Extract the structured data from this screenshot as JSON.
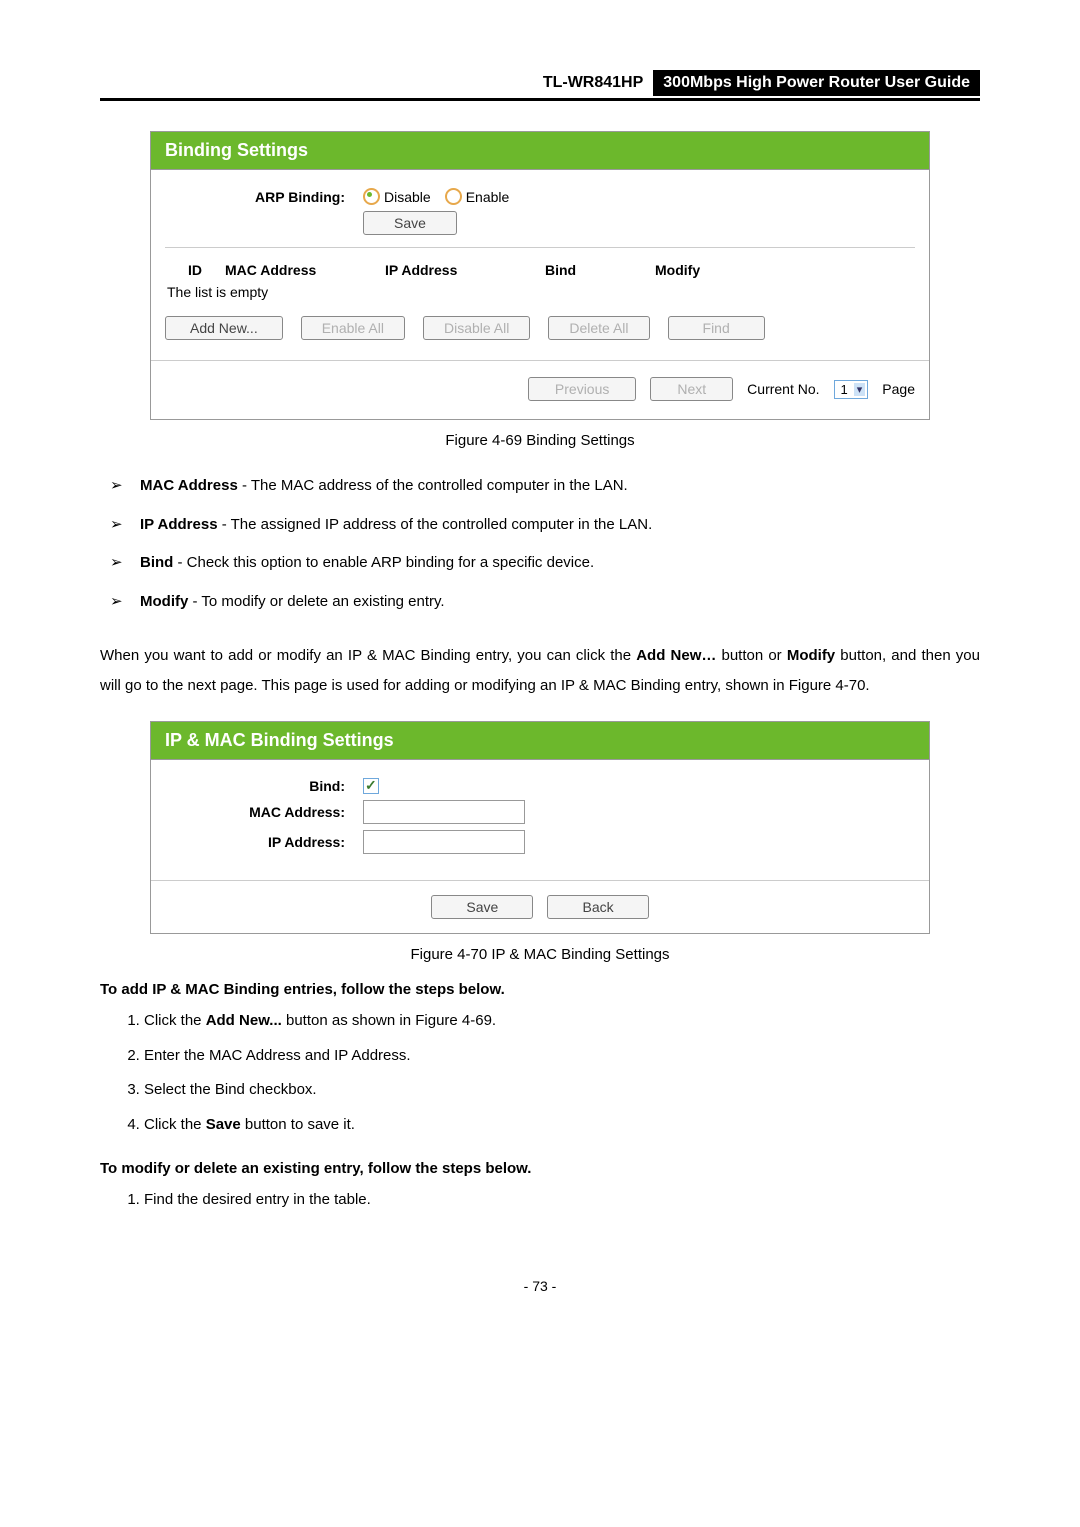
{
  "header": {
    "model": "TL-WR841HP",
    "title": "300Mbps High Power Router User Guide"
  },
  "panel1": {
    "title": "Binding Settings",
    "arp_label": "ARP Binding:",
    "disable": "Disable",
    "enable": "Enable",
    "save": "Save",
    "th_id": "ID",
    "th_mac": "MAC Address",
    "th_ip": "IP Address",
    "th_bind": "Bind",
    "th_mod": "Modify",
    "empty": "The list is empty",
    "add_new": "Add New...",
    "enable_all": "Enable All",
    "disable_all": "Disable All",
    "delete_all": "Delete All",
    "find": "Find",
    "previous": "Previous",
    "next": "Next",
    "current_no": "Current No.",
    "page_val": "1",
    "page": "Page"
  },
  "caption1": "Figure 4-69 Binding Settings",
  "bullets": [
    {
      "term": "MAC Address",
      "desc": " - The MAC address of the controlled computer in the LAN."
    },
    {
      "term": "IP Address",
      "desc": " - The assigned IP address of the controlled computer in the LAN."
    },
    {
      "term": "Bind",
      "desc": " - Check this option to enable ARP binding for a specific device."
    },
    {
      "term": "Modify",
      "desc": " - To modify or delete an existing entry."
    }
  ],
  "para1_pre": "When you want to add or modify an IP & MAC Binding entry, you can click the ",
  "para1_bold1": "Add New…",
  "para1_mid": " button or ",
  "para1_bold2": "Modify",
  "para1_post": " button, and then you will go to the next page. This page is used for adding or modifying an IP & MAC Binding entry, shown in Figure 4-70.",
  "panel2": {
    "title": "IP & MAC Binding Settings",
    "bind": "Bind:",
    "mac": "MAC Address:",
    "ip": "IP Address:",
    "save": "Save",
    "back": "Back"
  },
  "caption2": "Figure 4-70 IP & MAC Binding Settings",
  "section1": "To add IP & MAC Binding entries, follow the steps below.",
  "steps_add": {
    "s1a": "Click the ",
    "s1b": "Add New...",
    "s1c": " button as shown in Figure 4-69.",
    "s2": "Enter the MAC Address and IP Address.",
    "s3": "Select the Bind checkbox.",
    "s4a": "Click the ",
    "s4b": "Save",
    "s4c": " button to save it."
  },
  "section2": "To modify or delete an existing entry, follow the steps below.",
  "steps_mod": {
    "s1": "Find the desired entry in the table."
  },
  "page_number": "- 73 -"
}
